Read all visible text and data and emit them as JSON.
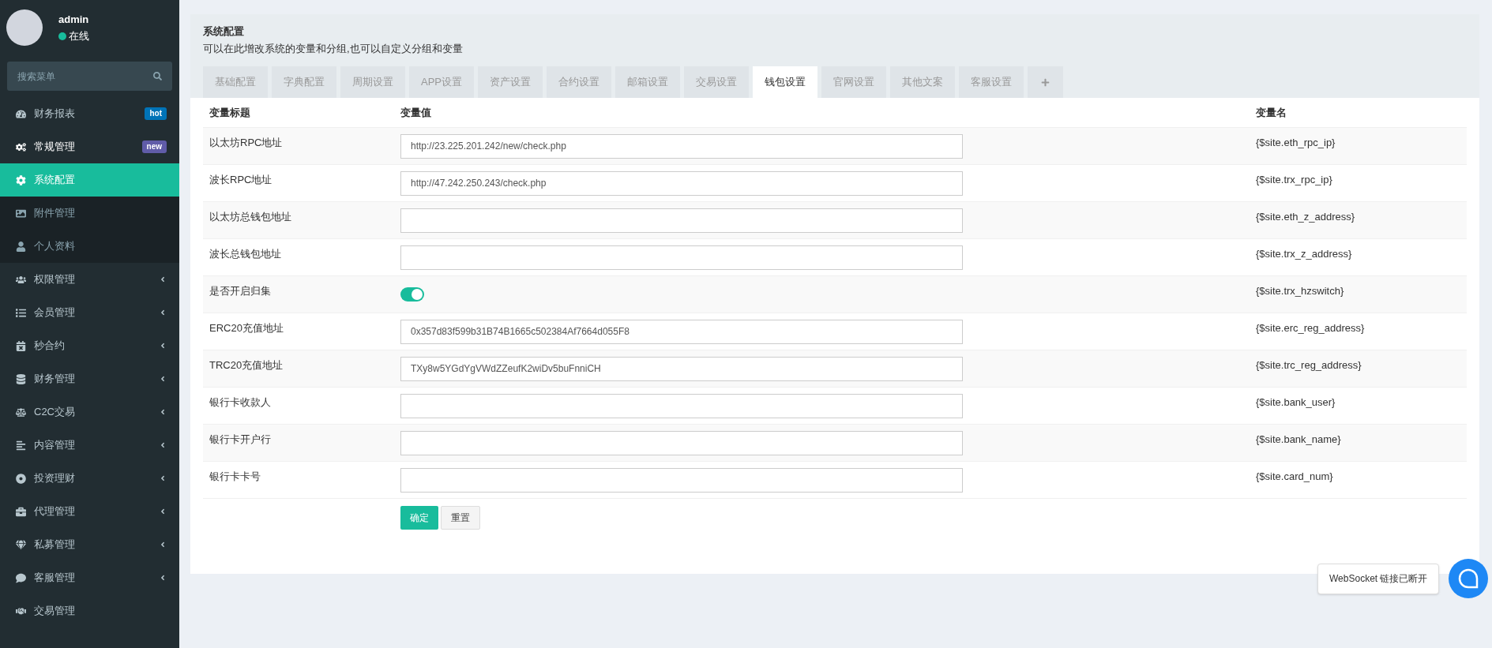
{
  "user": {
    "name": "admin",
    "status": "在线",
    "online": true
  },
  "sidebar": {
    "search": {
      "placeholder": "搜索菜单"
    },
    "items": [
      {
        "label": "财务报表",
        "kind": "link",
        "selected": false,
        "badge": {
          "text": "hot",
          "color": "#0073b7"
        }
      },
      {
        "label": "常规管理",
        "kind": "group",
        "selected": false,
        "expanded": true,
        "badge": {
          "text": "new",
          "color": "#605ca8"
        },
        "children": [
          {
            "label": "系统配置",
            "selected": true
          },
          {
            "label": "附件管理",
            "selected": false
          },
          {
            "label": "个人资料",
            "selected": false
          }
        ]
      },
      {
        "label": "权限管理",
        "kind": "group",
        "selected": false,
        "expanded": false
      },
      {
        "label": "会员管理",
        "kind": "group",
        "selected": false,
        "expanded": false
      },
      {
        "label": "秒合约",
        "kind": "group",
        "selected": false,
        "expanded": false
      },
      {
        "label": "财务管理",
        "kind": "group",
        "selected": false,
        "expanded": false
      },
      {
        "label": "C2C交易",
        "kind": "group",
        "selected": false,
        "expanded": false
      },
      {
        "label": "内容管理",
        "kind": "group",
        "selected": false,
        "expanded": false
      },
      {
        "label": "投资理财",
        "kind": "group",
        "selected": false,
        "expanded": false
      },
      {
        "label": "代理管理",
        "kind": "group",
        "selected": false,
        "expanded": false
      },
      {
        "label": "私募管理",
        "kind": "group",
        "selected": false,
        "expanded": false
      },
      {
        "label": "客服管理",
        "kind": "group",
        "selected": false,
        "expanded": false
      },
      {
        "label": "交易管理",
        "kind": "link",
        "selected": false
      }
    ]
  },
  "panel": {
    "title": "系统配置",
    "description": "可以在此增改系统的变量和分组,也可以自定义分组和变量",
    "tabs": [
      {
        "label": "基础配置",
        "selected": false
      },
      {
        "label": "字典配置",
        "selected": false
      },
      {
        "label": "周期设置",
        "selected": false
      },
      {
        "label": "APP设置",
        "selected": false
      },
      {
        "label": "资产设置",
        "selected": false
      },
      {
        "label": "合约设置",
        "selected": false
      },
      {
        "label": "邮箱设置",
        "selected": false
      },
      {
        "label": "交易设置",
        "selected": false
      },
      {
        "label": "钱包设置",
        "selected": true
      },
      {
        "label": "官网设置",
        "selected": false
      },
      {
        "label": "其他文案",
        "selected": false
      },
      {
        "label": "客服设置",
        "selected": false
      }
    ],
    "table": {
      "columns": [
        "变量标题",
        "变量值",
        "变量名"
      ],
      "rows": [
        {
          "title": "以太坊RPC地址",
          "kind": "text",
          "value": "http://23.225.201.242/new/check.php",
          "variable": "{$site.eth_rpc_ip}"
        },
        {
          "title": "波长RPC地址",
          "kind": "text",
          "value": "http://47.242.250.243/check.php",
          "variable": "{$site.trx_rpc_ip}"
        },
        {
          "title": "以太坊总钱包地址",
          "kind": "text",
          "variable": "{$site.eth_z_address}"
        },
        {
          "title": "波长总钱包地址",
          "kind": "text",
          "variable": "{$site.trx_z_address}"
        },
        {
          "title": "是否开启归集",
          "kind": "switch",
          "on": true,
          "variable": "{$site.trx_hzswitch}"
        },
        {
          "title": "ERC20充值地址",
          "kind": "text",
          "value": "0x357d83f599b31B74B1665c502384Af7664d055F8",
          "variable": "{$site.erc_reg_address}"
        },
        {
          "title": "TRC20充值地址",
          "kind": "text",
          "value": "TXy8w5YGdYgVWdZZeufK2wiDv5buFnniCH",
          "variable": "{$site.trc_reg_address}"
        },
        {
          "title": "银行卡收款人",
          "kind": "text",
          "variable": "{$site.bank_user}"
        },
        {
          "title": "银行卡开户行",
          "kind": "text",
          "variable": "{$site.bank_name}"
        },
        {
          "title": "银行卡卡号",
          "kind": "text",
          "variable": "{$site.card_num}"
        }
      ]
    },
    "buttons": [
      {
        "label": "确定",
        "kind": "primary"
      },
      {
        "label": "重置",
        "kind": "default"
      }
    ]
  },
  "notification": {
    "text": "WebSocket 链接已断开"
  }
}
